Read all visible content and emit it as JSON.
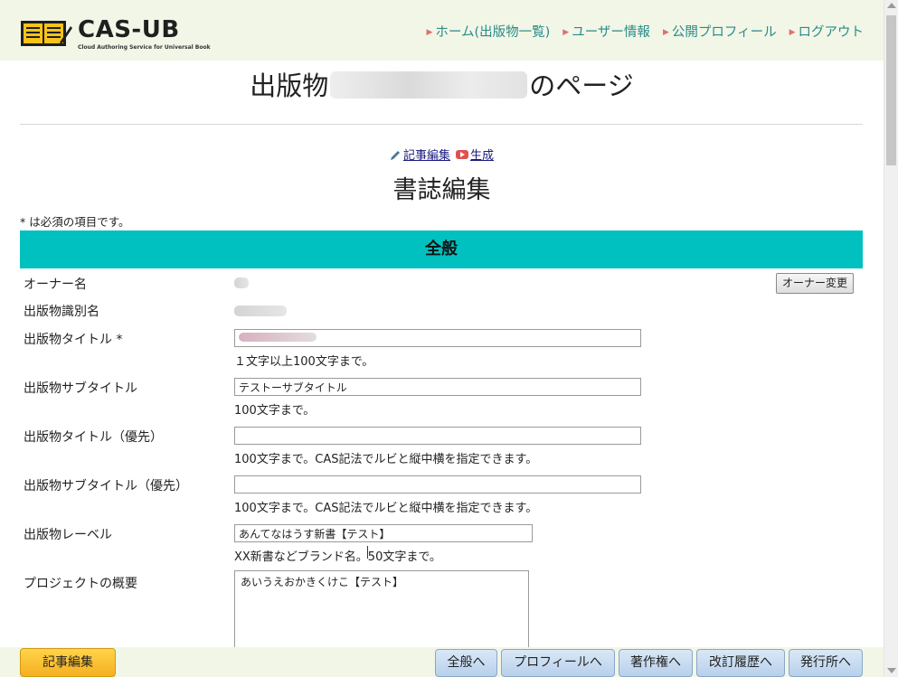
{
  "header": {
    "logo_text": "CAS-UB",
    "logo_sub": "Cloud Authoring Service for Universal Book",
    "nav": [
      "ホーム(出版物一覧)",
      "ユーザー情報",
      "公開プロフィール",
      "ログアウト"
    ]
  },
  "page": {
    "title_prefix": "出版物",
    "title_suffix": "のページ",
    "action_edit": "記事編集",
    "action_generate": "生成",
    "section_title": "書誌編集",
    "required_note": "* は必須の項目です。"
  },
  "general": {
    "band_title": "全般",
    "owner_label": "オーナー名",
    "owner_change_button": "オーナー変更",
    "id_label": "出版物識別名",
    "title_label": "出版物タイトル *",
    "title_value": "",
    "title_hint": "１文字以上100文字まで。",
    "subtitle_label": "出版物サブタイトル",
    "subtitle_value": "テストーサブタイトル",
    "subtitle_hint": "100文字まで。",
    "title_priority_label": "出版物タイトル（優先）",
    "title_priority_value": "",
    "title_priority_hint": "100文字まで。CAS記法でルビと縦中横を指定できます。",
    "subtitle_priority_label": "出版物サブタイトル（優先）",
    "subtitle_priority_value": "",
    "subtitle_priority_hint": "100文字まで。CAS記法でルビと縦中横を指定できます。",
    "label_label": "出版物レーベル",
    "label_value": "あんてなはうす新書【テスト】",
    "label_hint": "XX新書などブランド名。50文字まで。",
    "summary_label": "プロジェクトの概要",
    "summary_value": "あいうえおかきくけこ【テスト】"
  },
  "footer": {
    "edit_button": "記事編集",
    "jumps": [
      "全般へ",
      "プロフィールへ",
      "著作権へ",
      "改訂履歴へ",
      "発行所へ"
    ]
  },
  "colors": {
    "band": "#00c0c0",
    "header_bg": "#f2f6e6",
    "nav_link": "#2a8a8a",
    "edit_button": "#f5b020"
  }
}
